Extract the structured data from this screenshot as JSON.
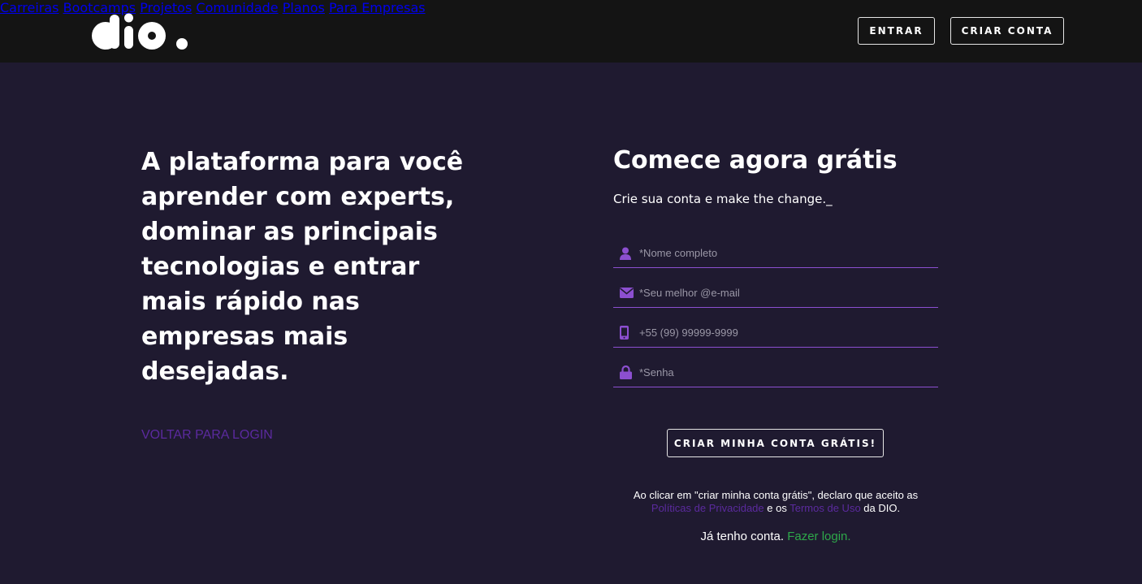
{
  "header": {
    "logo_text": "dio.",
    "nav": [
      "Carreiras",
      "Bootcamps",
      "Projetos",
      "Comunidade",
      "Planos",
      "Para Empresas"
    ],
    "login_button": "ENTRAR",
    "signup_button": "CRIAR CONTA"
  },
  "hero": {
    "headline": "A plataforma para você aprender com experts, dominar as principais tecnologias e entrar mais rápido nas empresas mais desejadas.",
    "back_link": "VOLTAR PARA LOGIN"
  },
  "form": {
    "title": "Comece agora grátis",
    "subtitle": "Crie sua conta e make the change._",
    "name_placeholder": "*Nome completo",
    "email_placeholder": "*Seu melhor @e-mail",
    "phone_placeholder": "+55 (99) 99999-9999",
    "password_placeholder": "*Senha",
    "submit_label": "CRIAR MINHA CONTA GRÁTIS!",
    "terms_prefix": "Ao clicar em \"criar minha conta grátis\", declaro que aceito as",
    "privacy_link": "Políticas de Privacidade",
    "terms_and": "e os",
    "terms_link": "Termos de Uso",
    "terms_suffix": "da DIO.",
    "have_account": "Já tenho conta.",
    "login_link": "Fazer login."
  },
  "colors": {
    "background": "#1f1a30",
    "topbar": "#141414",
    "accent_purple": "#8c4fd0",
    "link_purple": "#5b2a9e",
    "link_green": "#2ea84a"
  },
  "icons": [
    "user-icon",
    "envelope-icon",
    "phone-icon",
    "lock-icon"
  ]
}
